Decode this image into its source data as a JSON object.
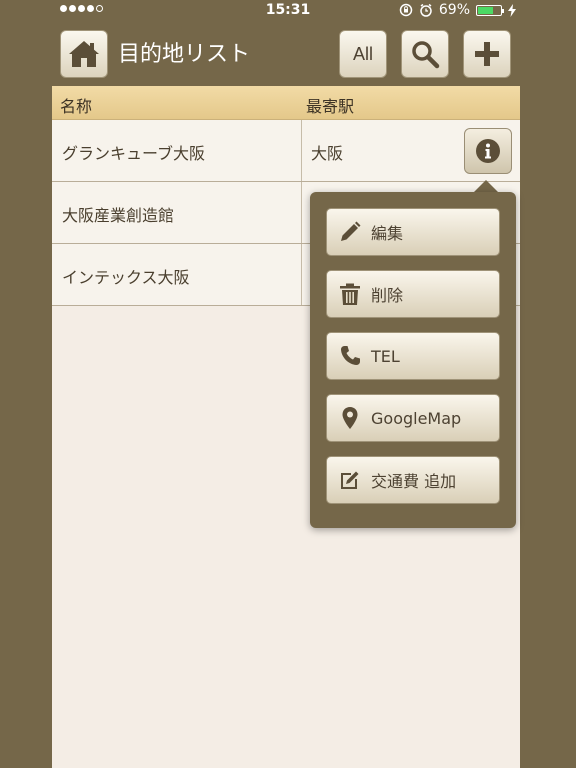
{
  "status_bar": {
    "time": "15:31",
    "battery": "69%",
    "battery_level": 0.69
  },
  "nav": {
    "title": "目的地リスト",
    "all_label": "All",
    "icons": [
      "home-icon",
      "search-icon",
      "plus-icon"
    ]
  },
  "table": {
    "headers": {
      "name": "名称",
      "station": "最寄駅"
    },
    "rows": [
      {
        "name": "グランキューブ大阪",
        "station": "大阪"
      },
      {
        "name": "大阪産業創造館",
        "station": ""
      },
      {
        "name": "インテックス大阪",
        "station": ""
      }
    ]
  },
  "popover": {
    "items": [
      {
        "label": "編集",
        "icon": "pencil-icon"
      },
      {
        "label": "削除",
        "icon": "trash-icon"
      },
      {
        "label": "TEL",
        "icon": "phone-icon"
      },
      {
        "label": "GoogleMap",
        "icon": "map-pin-icon"
      },
      {
        "label": "交通費 追加",
        "icon": "edit-box-icon"
      }
    ]
  },
  "colors": {
    "background": "#756749",
    "header": "#e9cf94",
    "panel": "#f4ede5",
    "battery": "#4cd964"
  }
}
